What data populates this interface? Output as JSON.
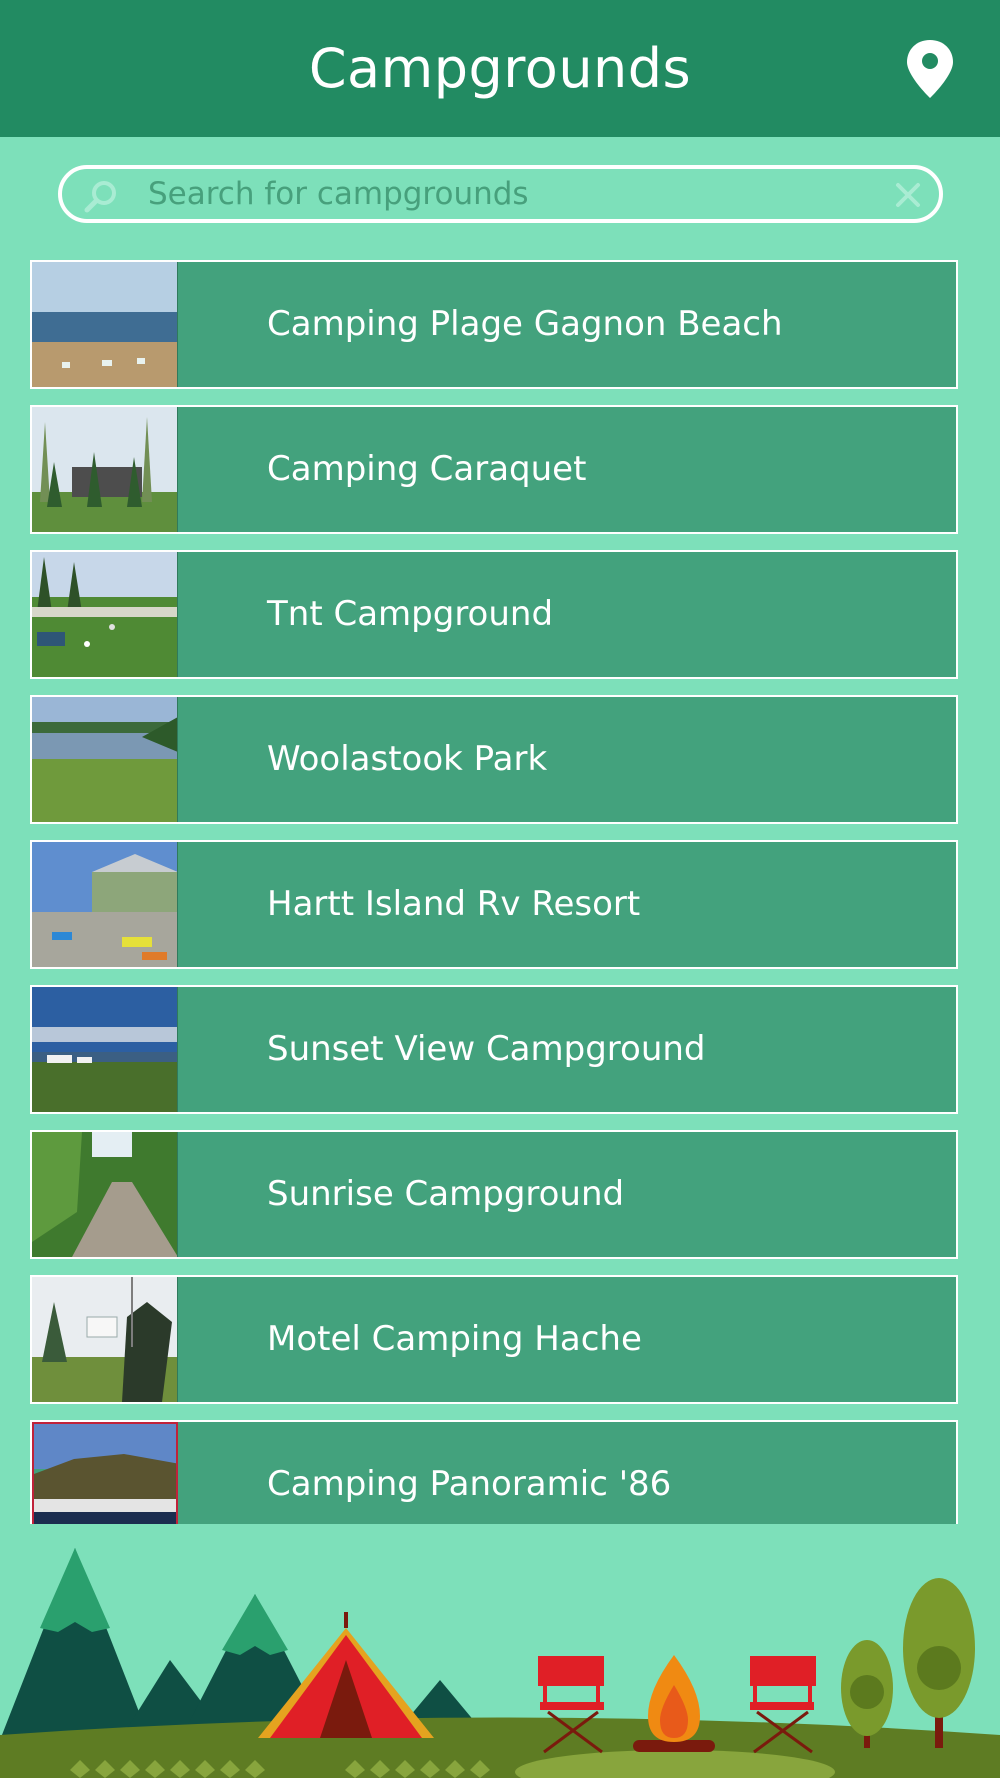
{
  "header": {
    "title": "Campgrounds",
    "map_icon": "map-pin-icon"
  },
  "search": {
    "placeholder": "Search for campgrounds",
    "value": "",
    "search_icon": "magnifier-icon",
    "clear_icon": "close-icon"
  },
  "campgrounds": [
    {
      "name": "Camping Plage Gagnon Beach"
    },
    {
      "name": "Camping Caraquet"
    },
    {
      "name": "Tnt Campground"
    },
    {
      "name": "Woolastook Park"
    },
    {
      "name": "Hartt Island Rv Resort"
    },
    {
      "name": "Sunset View Campground"
    },
    {
      "name": "Sunrise Campground"
    },
    {
      "name": "Motel Camping Hache"
    },
    {
      "name": "Camping Panoramic '86"
    }
  ],
  "colors": {
    "header": "#228b62",
    "background": "#7de0ba",
    "row": "#43a27d",
    "text": "#ffffff"
  }
}
